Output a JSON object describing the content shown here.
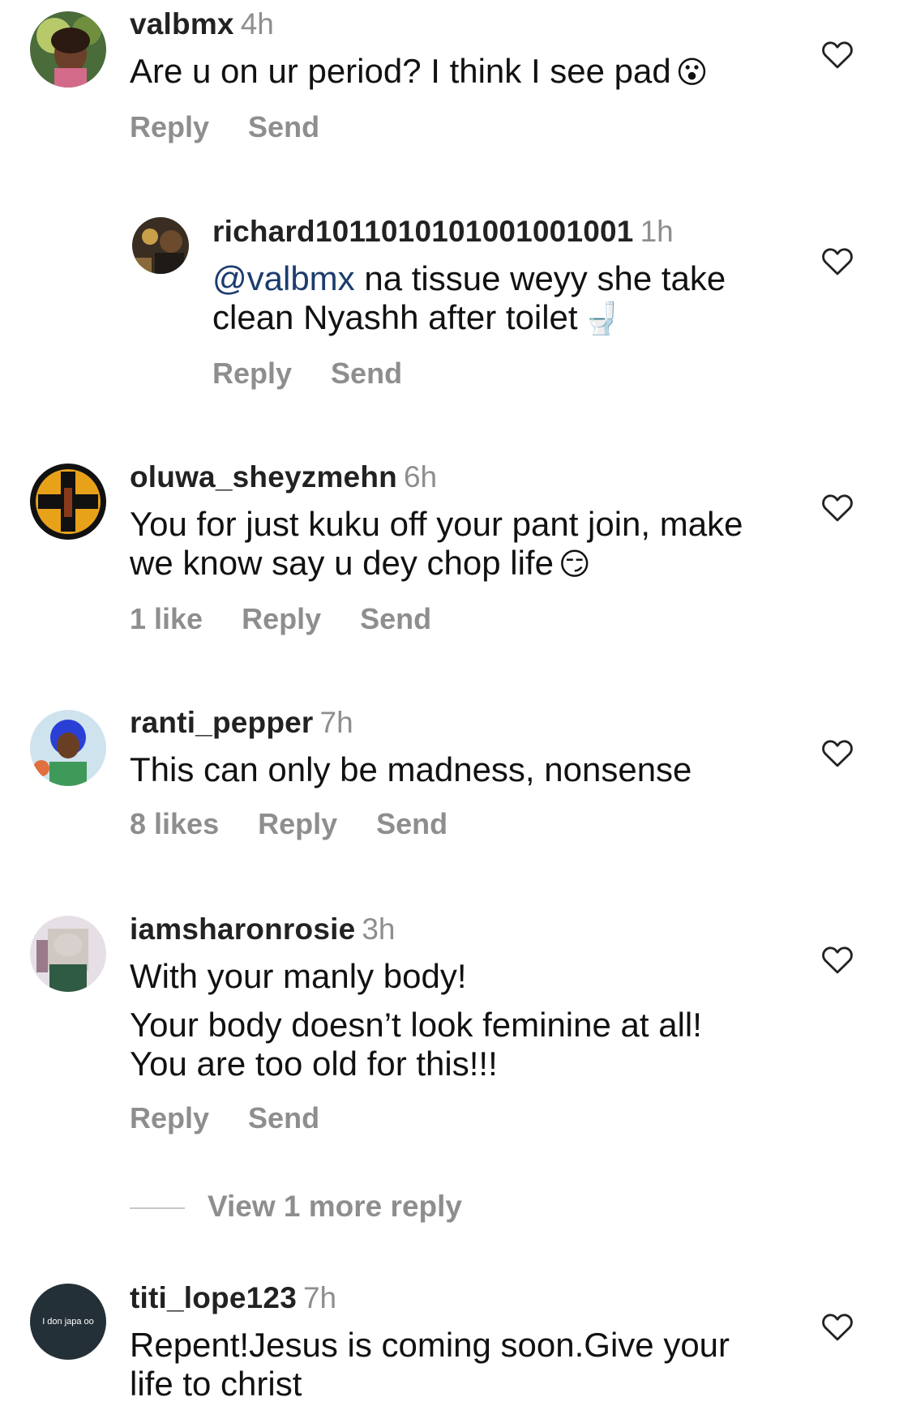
{
  "comments": [
    {
      "username": "valbmx",
      "time": "4h",
      "text_lines": [
        "Are u on ur period? I think I see pad"
      ],
      "emoji": "😮",
      "actions": {
        "reply": "Reply",
        "send": "Send"
      }
    },
    {
      "username": "richard1011010101001001001",
      "time": "1h",
      "mention": "@valbmx",
      "text_line1_rest": " na tissue weyy she take",
      "text_line2": "clean Nyashh after toilet",
      "emoji": "🚽",
      "actions": {
        "reply": "Reply",
        "send": "Send"
      }
    },
    {
      "username": "oluwa_sheyzmehn",
      "time": "6h",
      "text_lines": [
        "You for just kuku off your pant join, make",
        "we know say u dey chop life"
      ],
      "emoji": "😏",
      "actions": {
        "likes": "1 like",
        "reply": "Reply",
        "send": "Send"
      }
    },
    {
      "username": "ranti_pepper",
      "time": "7h",
      "text_lines": [
        "This can only be madness, nonsense"
      ],
      "actions": {
        "likes": "8 likes",
        "reply": "Reply",
        "send": "Send"
      }
    },
    {
      "username": "iamsharonrosie",
      "time": "3h",
      "text_lines": [
        "With your manly body!",
        "Your body doesn’t look feminine at all!",
        "You are too old for this!!!"
      ],
      "actions": {
        "reply": "Reply",
        "send": "Send"
      }
    },
    {
      "username": "titi_lope123",
      "time": "7h",
      "avatar_text": "I don japa oo",
      "text_lines": [
        "Repent!Jesus is coming soon.Give your",
        "life to christ"
      ]
    }
  ],
  "view_more_replies": "View 1 more reply",
  "icons": {
    "like": "heart-outline-icon"
  },
  "colors": {
    "secondary_text": "#8e8e8e",
    "mention": "#1c3c6e"
  }
}
